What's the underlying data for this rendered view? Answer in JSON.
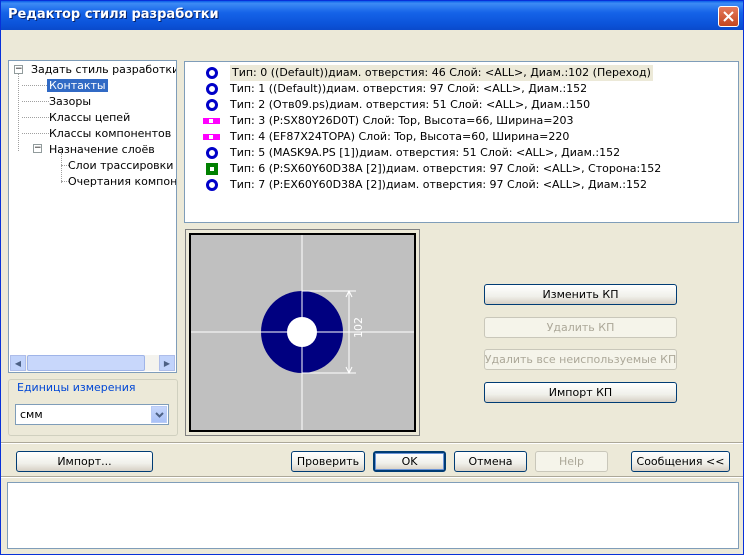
{
  "window": {
    "title": "Редактор стиля разработки"
  },
  "tree": {
    "items": [
      {
        "label": "Задать стиль разработки",
        "expander": "−"
      },
      {
        "label": "Контакты"
      },
      {
        "label": "Зазоры"
      },
      {
        "label": "Классы цепей"
      },
      {
        "label": "Классы компонентов"
      },
      {
        "label": "Назначение слоёв",
        "expander": "−"
      },
      {
        "label": "Слои трассировки"
      },
      {
        "label": "Очертания компонентов"
      }
    ],
    "selected": "Контакты"
  },
  "units": {
    "legend": "Единицы измерения",
    "value": "смм"
  },
  "padstacks": [
    {
      "text": "Тип: 0 ((Default))диам. отверстия: 46 Слой: <ALL>, Диам.:102   (Переход)",
      "icon": "round-pad-icon"
    },
    {
      "text": "Тип: 1 ((Default))диам. отверстия: 97 Слой: <ALL>, Диам.:152",
      "icon": "round-pad-icon"
    },
    {
      "text": "Тип: 2 (Отв09.ps)диам. отверстия: 51 Слой: <ALL>, Диам.:150",
      "icon": "round-pad-icon"
    },
    {
      "text": "Тип: 3 (P:SX80Y26D0T) Слой: Top, Высота=66, Ширина=203",
      "icon": "rect-pad-icon"
    },
    {
      "text": "Тип: 4 (EF87X24TOPA) Слой: Top, Высота=60, Ширина=220",
      "icon": "rect-pad-icon"
    },
    {
      "text": "Тип: 5 (MASK9A.PS [1])диам. отверстия: 51 Слой: <ALL>, Диам.:152",
      "icon": "round-pad-icon"
    },
    {
      "text": "Тип: 6 (P:SX60Y60D38A [2])диам. отверстия: 97 Слой: <ALL>, Сторона:152",
      "icon": "square-pad-icon"
    },
    {
      "text": "Тип: 7 (P:EX60Y60D38A [2])диам. отверстия: 97 Слой: <ALL>, Диам.:152",
      "icon": "round-pad-icon"
    }
  ],
  "preview": {
    "dimension_label": "102",
    "pad_color": "#000080",
    "hole_color": "#ffffff"
  },
  "actions": {
    "edit": "Изменить КП",
    "delete": "Удалить КП",
    "delete_unused": "Удалить все неиспользуемые КП",
    "import_pad": "Импорт КП"
  },
  "footer": {
    "import": "Импорт...",
    "check": "Проверить",
    "ok": "OK",
    "cancel": "Отмена",
    "help": "Help",
    "messages": "Сообщения <<"
  },
  "colors": {
    "titlebar": "#0a5fe9",
    "selection": "#316ac5",
    "window_bg": "#ece9d8"
  }
}
